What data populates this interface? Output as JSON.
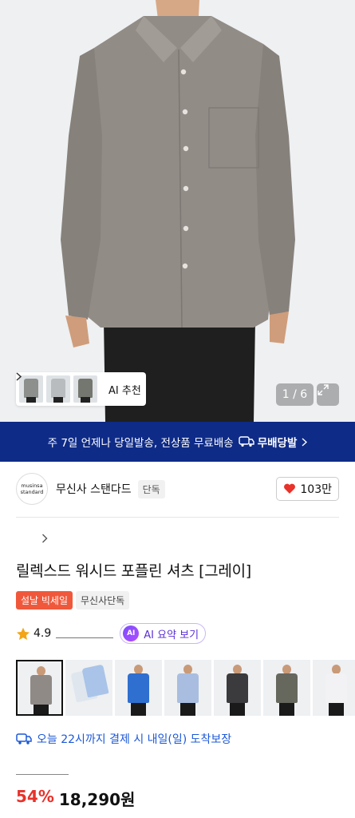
{
  "hero": {
    "pager": "1 / 6",
    "ai_recommend_label": "AI 추천",
    "thumb_colors": [
      "#8d8f8c",
      "#b9bcbe",
      "#74776f"
    ]
  },
  "banner": {
    "text": "주 7일 언제나 당일발송, 전상품 무료배송",
    "badge": "무배당발"
  },
  "brand": {
    "logo_line1": "musinsa",
    "logo_line2": "standard",
    "name": "무신사 스탠다드",
    "tag": "단독",
    "likes": "103만"
  },
  "product": {
    "title": "릴렉스드 워시드 포플린 셔츠 [그레이]",
    "badge_sale": "설날 빅세일",
    "badge_exclusive": "무신사단독",
    "rating": "4.9",
    "ai_summary_label": "AI 요약 보기",
    "ai_dot": "AI"
  },
  "color_options": [
    {
      "color": "#8f8a86",
      "selected": true
    },
    {
      "color": "#dfe6ee",
      "selected": false
    },
    {
      "color": "#2f6fd0",
      "selected": false
    },
    {
      "color": "#a9bde0",
      "selected": false
    },
    {
      "color": "#3b3b3d",
      "selected": false
    },
    {
      "color": "#66685e",
      "selected": false
    },
    {
      "color": "#f2f2f4",
      "selected": false
    }
  ],
  "delivery": {
    "text": "오늘 22시까지 결제 시 내일(일) 도착보장"
  },
  "price": {
    "discount": "54%",
    "amount": "18,290원"
  },
  "colors": {
    "banner_bg": "#0e2b87",
    "accent_red": "#e8322a",
    "delivery_blue": "#1c58d8",
    "ai_purple": "#5a2fd6"
  }
}
